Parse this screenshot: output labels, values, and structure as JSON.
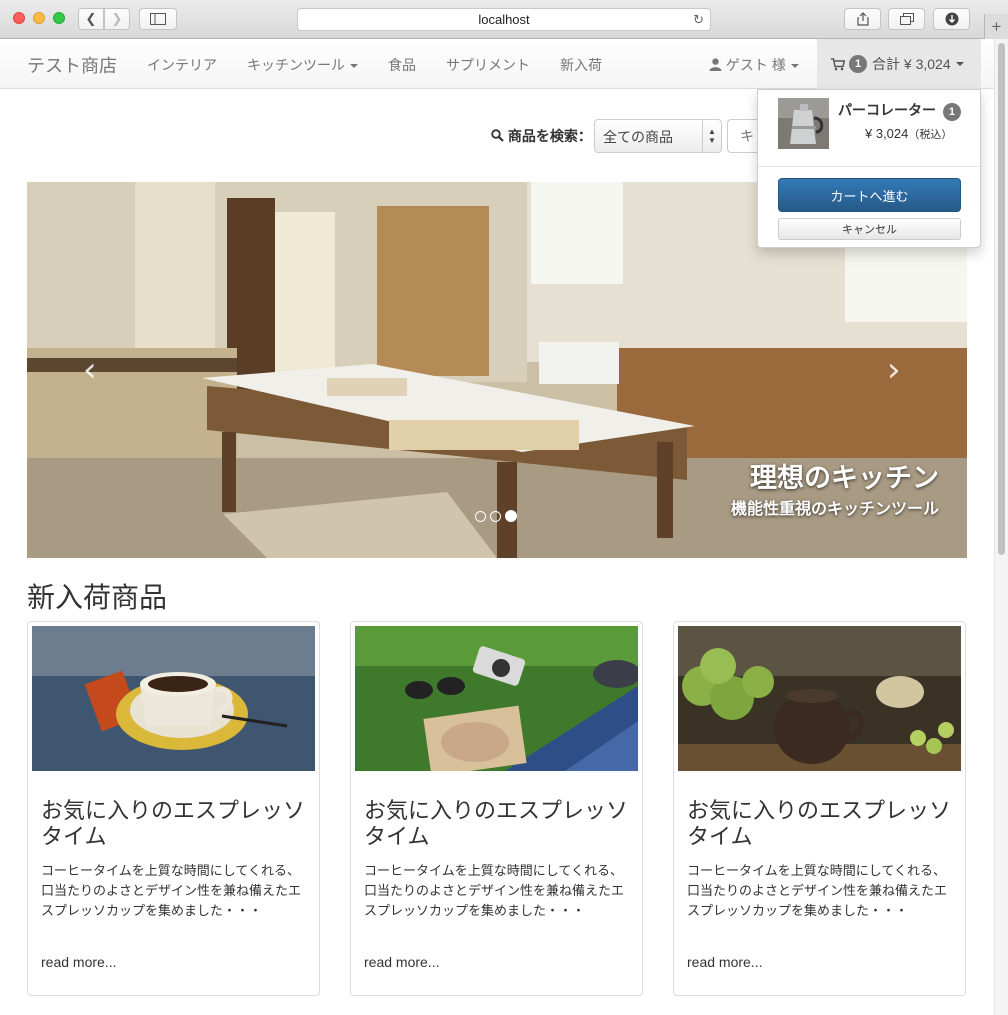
{
  "browser": {
    "url": "localhost"
  },
  "navbar": {
    "brand": "テスト商店",
    "items": [
      {
        "label": "インテリア"
      },
      {
        "label": "キッチンツール"
      },
      {
        "label": "食品"
      },
      {
        "label": "サプリメント"
      },
      {
        "label": "新入荷"
      }
    ],
    "user_label": "ゲスト 様",
    "cart_count": "1",
    "cart_total": "合計 ¥ 3,024"
  },
  "search": {
    "label": "商品を検索：",
    "category_selected": "全ての商品",
    "keyword_placeholder": "キー"
  },
  "carousel": {
    "title": "理想のキッチン",
    "subtitle": "機能性重視のキッチンツール",
    "prev": "‹",
    "next": "›",
    "slide_count": 3,
    "active_slide": 3
  },
  "new_arrivals": {
    "heading": "新入荷商品",
    "cards": [
      {
        "title": "お気に入りのエスプレッソタイム",
        "text": "コーヒータイムを上質な時間にしてくれる、口当たりのよさとデザイン性を兼ね備えたエスプレッソカップを集めました・・・",
        "more": "read more..."
      },
      {
        "title": "お気に入りのエスプレッソタイム",
        "text": "コーヒータイムを上質な時間にしてくれる、口当たりのよさとデザイン性を兼ね備えたエスプレッソカップを集めました・・・",
        "more": "read more..."
      },
      {
        "title": "お気に入りのエスプレッソタイム",
        "text": "コーヒータイムを上質な時間にしてくれる、口当たりのよさとデザイン性を兼ね備えたエスプレッソカップを集めました・・・",
        "more": "read more..."
      }
    ]
  },
  "cart_dropdown": {
    "item_name": "パーコレーター",
    "item_qty": "1",
    "item_price": "¥ 3,024",
    "item_tax": "（税込）",
    "proceed_label": "カートへ進む",
    "cancel_label": "キャンセル"
  },
  "icons": {
    "user": "user-icon",
    "cart": "shopping-cart-icon",
    "search": "search-icon"
  },
  "colors": {
    "primary_button": "#337ab7",
    "badge": "#777777",
    "active_nav_bg": "#e7e7e7"
  }
}
